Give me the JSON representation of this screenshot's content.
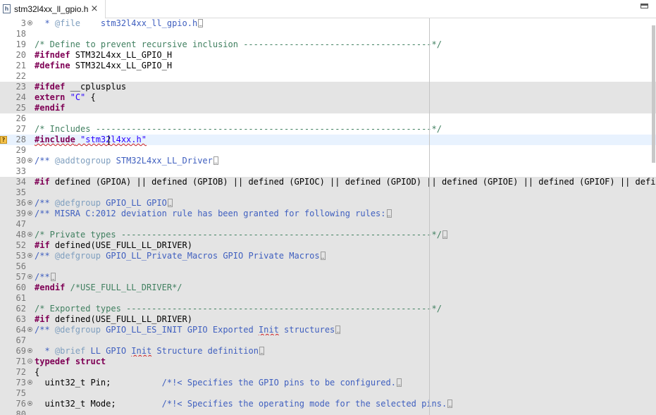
{
  "tab": {
    "title": "stm32l4xx_ll_gpio.h",
    "icon": "h",
    "close": "×"
  },
  "lines": [
    {
      "n": "3",
      "fold": "plus",
      "segs": [
        {
          "c": "doc",
          "t": "  * "
        },
        {
          "c": "tag",
          "t": "@file"
        },
        {
          "c": "doc",
          "t": "    stm32l4xx_ll_gpio.h"
        }
      ],
      "ellipsis": true
    },
    {
      "n": "18"
    },
    {
      "n": "19",
      "segs": [
        {
          "c": "cmt",
          "t": "/* Define to prevent recursive inclusion -------------------------------------*/"
        }
      ]
    },
    {
      "n": "20",
      "segs": [
        {
          "c": "kw",
          "t": "#ifndef"
        },
        {
          "c": "",
          "t": " STM32L4xx_LL_GPIO_H"
        }
      ]
    },
    {
      "n": "21",
      "segs": [
        {
          "c": "kw",
          "t": "#define"
        },
        {
          "c": "",
          "t": " STM32L4xx_LL_GPIO_H"
        }
      ]
    },
    {
      "n": "22"
    },
    {
      "n": "23",
      "shade": true,
      "segs": [
        {
          "c": "kw",
          "t": "#ifdef"
        },
        {
          "c": "",
          "t": " __cplusplus"
        }
      ]
    },
    {
      "n": "24",
      "shade": true,
      "segs": [
        {
          "c": "kw",
          "t": "extern"
        },
        {
          "c": "",
          "t": " "
        },
        {
          "c": "str",
          "t": "\"C\""
        },
        {
          "c": "",
          "t": " {"
        }
      ]
    },
    {
      "n": "25",
      "shade": true,
      "segs": [
        {
          "c": "kw",
          "t": "#endif"
        }
      ]
    },
    {
      "n": "26"
    },
    {
      "n": "27",
      "segs": [
        {
          "c": "cmt",
          "t": "/* Includes ------------------------------------------------------------------*/"
        }
      ]
    },
    {
      "n": "28",
      "current": true,
      "warn": true,
      "segs": [
        {
          "c": "kw squig",
          "t": "#include"
        },
        {
          "c": "squig",
          "t": " "
        },
        {
          "c": "str squig",
          "t": "\"stm32l4xx.h\""
        }
      ]
    },
    {
      "n": "29"
    },
    {
      "n": "30",
      "fold": "plus",
      "segs": [
        {
          "c": "doc",
          "t": "/** "
        },
        {
          "c": "tag",
          "t": "@addtogroup"
        },
        {
          "c": "doc",
          "t": " STM32L4xx_LL_Driver"
        }
      ],
      "ellipsis": true
    },
    {
      "n": "33"
    },
    {
      "n": "34",
      "shade": true,
      "segs": [
        {
          "c": "kw",
          "t": "#if"
        },
        {
          "c": "",
          "t": " defined (GPIOA) || defined (GPIOB) || defined (GPIOC) || defined (GPIOD) || defined (GPIOE) || defined (GPIOF) || defined (GPIOG)"
        }
      ]
    },
    {
      "n": "35",
      "shade": true
    },
    {
      "n": "36",
      "shade": true,
      "fold": "plus",
      "segs": [
        {
          "c": "doc",
          "t": "/** "
        },
        {
          "c": "tag",
          "t": "@defgroup"
        },
        {
          "c": "doc",
          "t": " GPIO_LL GPIO"
        }
      ],
      "ellipsis": true
    },
    {
      "n": "39",
      "shade": true,
      "fold": "plus",
      "segs": [
        {
          "c": "doc",
          "t": "/** MISRA C:2012 deviation rule has been granted for following rules:"
        }
      ],
      "ellipsis": true
    },
    {
      "n": "47",
      "shade": true
    },
    {
      "n": "48",
      "shade": true,
      "fold": "plus",
      "segs": [
        {
          "c": "cmt",
          "t": "/* Private types -------------------------------------------------------------*/"
        }
      ],
      "ellipsis": true
    },
    {
      "n": "52",
      "shade": true,
      "segs": [
        {
          "c": "kw",
          "t": "#if"
        },
        {
          "c": "",
          "t": " defined(USE_FULL_LL_DRIVER)"
        }
      ]
    },
    {
      "n": "53",
      "shade": true,
      "fold": "plus",
      "segs": [
        {
          "c": "doc",
          "t": "/** "
        },
        {
          "c": "tag",
          "t": "@defgroup"
        },
        {
          "c": "doc",
          "t": " GPIO_LL_Private_Macros GPIO Private Macros"
        }
      ],
      "ellipsis": true
    },
    {
      "n": "56",
      "shade": true
    },
    {
      "n": "57",
      "shade": true,
      "fold": "plus",
      "segs": [
        {
          "c": "doc",
          "t": "/**"
        }
      ],
      "ellipsis": true
    },
    {
      "n": "60",
      "shade": true,
      "segs": [
        {
          "c": "kw",
          "t": "#endif"
        },
        {
          "c": "",
          "t": " "
        },
        {
          "c": "cmt",
          "t": "/*USE_FULL_LL_DRIVER*/"
        }
      ]
    },
    {
      "n": "61",
      "shade": true
    },
    {
      "n": "62",
      "shade": true,
      "segs": [
        {
          "c": "cmt",
          "t": "/* Exported types ------------------------------------------------------------*/"
        }
      ]
    },
    {
      "n": "63",
      "shade": true,
      "segs": [
        {
          "c": "kw",
          "t": "#if"
        },
        {
          "c": "",
          "t": " defined(USE_FULL_LL_DRIVER)"
        }
      ]
    },
    {
      "n": "64",
      "shade": true,
      "fold": "plus",
      "segs": [
        {
          "c": "doc",
          "t": "/** "
        },
        {
          "c": "tag",
          "t": "@defgroup"
        },
        {
          "c": "doc",
          "t": " GPIO_LL_ES_INIT GPIO Exported "
        },
        {
          "c": "doc squig",
          "t": "Init"
        },
        {
          "c": "doc",
          "t": " structures"
        }
      ],
      "ellipsis": true
    },
    {
      "n": "67",
      "shade": true
    },
    {
      "n": "69",
      "shade": true,
      "fold": "plus",
      "segs": [
        {
          "c": "doc",
          "t": "  * "
        },
        {
          "c": "tag",
          "t": "@brief"
        },
        {
          "c": "doc",
          "t": " LL GPIO "
        },
        {
          "c": "doc squig",
          "t": "Init"
        },
        {
          "c": "doc",
          "t": " Structure definition"
        }
      ],
      "ellipsis": true
    },
    {
      "n": "71",
      "shade": true,
      "fold": "minus",
      "segs": [
        {
          "c": "kw",
          "t": "typedef"
        },
        {
          "c": "",
          "t": " "
        },
        {
          "c": "kw",
          "t": "struct"
        }
      ]
    },
    {
      "n": "72",
      "shade": true,
      "segs": [
        {
          "c": "",
          "t": "{"
        }
      ]
    },
    {
      "n": "73",
      "shade": true,
      "fold": "plus",
      "segs": [
        {
          "c": "",
          "t": "  uint32_t Pin;          "
        },
        {
          "c": "doc",
          "t": "/*!< Specifies the GPIO pins to be configured."
        }
      ],
      "ellipsis": true
    },
    {
      "n": "75",
      "shade": true
    },
    {
      "n": "76",
      "shade": true,
      "fold": "plus",
      "segs": [
        {
          "c": "",
          "t": "  uint32_t Mode;         "
        },
        {
          "c": "doc",
          "t": "/*!< Specifies the operating mode for the selected pins."
        }
      ],
      "ellipsis": true
    },
    {
      "n": "80",
      "shade": true
    }
  ]
}
